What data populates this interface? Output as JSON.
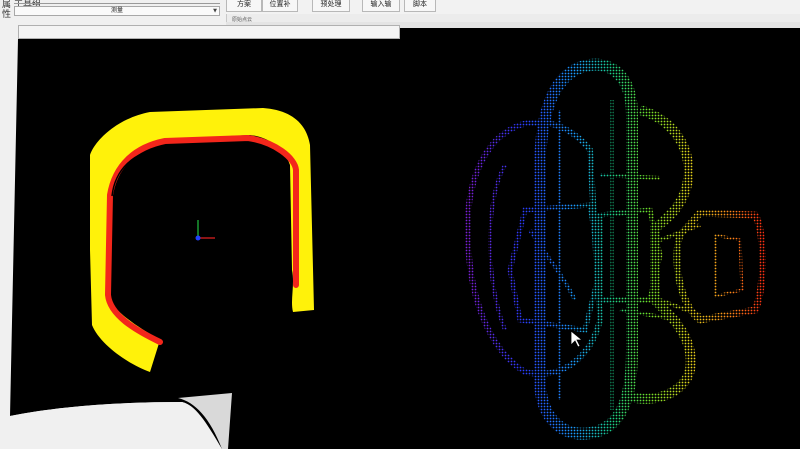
{
  "panel": {
    "title": "属性",
    "group_label": "工具组",
    "measure_select": "测量",
    "viewport_caption": "原始点云"
  },
  "toolbar": {
    "tabs": [
      "方案",
      "位置补",
      "预处理",
      "输入输",
      "脚本"
    ]
  },
  "colors": {
    "yellow_band": "#fff20a",
    "red_band": "#f3261b",
    "viewport_bg": "#000000"
  },
  "icons": {
    "dropdown": "chevron-down-icon",
    "axis": "xyz-axis-icon",
    "cursor": "mouse-pointer-icon"
  }
}
